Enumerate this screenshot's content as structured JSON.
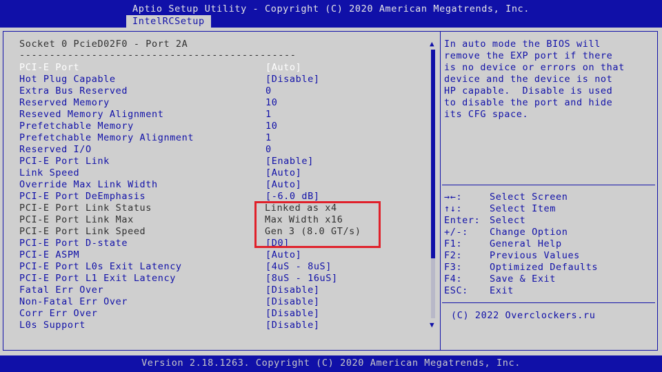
{
  "header": {
    "title": "Aptio Setup Utility - Copyright (C) 2020 American Megatrends, Inc.",
    "tab": "IntelRCSetup"
  },
  "section": {
    "title": "Socket 0 PcieD02F0 - Port 2A",
    "divider": "----------------------------------------------"
  },
  "settings": [
    {
      "label": "PCI-E Port",
      "value": "[Auto]"
    },
    {
      "label": "Hot Plug Capable",
      "value": "[Disable]"
    },
    {
      "label": "Extra Bus Reserved",
      "value": "0"
    },
    {
      "label": "Reserved Memory",
      "value": "10"
    },
    {
      "label": "Reseved Memory Alignment",
      "value": "1"
    },
    {
      "label": "Prefetchable Memory",
      "value": "10"
    },
    {
      "label": "Prefetchable Memory Alignment",
      "value": "1"
    },
    {
      "label": "Reserved I/O",
      "value": "0"
    },
    {
      "label": "PCI-E Port Link",
      "value": "[Enable]"
    },
    {
      "label": "Link Speed",
      "value": "[Auto]"
    },
    {
      "label": "Override Max Link Width",
      "value": "[Auto]"
    },
    {
      "label": "PCI-E Port DeEmphasis",
      "value": "[-6.0 dB]"
    },
    {
      "label": "PCI-E Port Link Status",
      "value": "Linked as x4"
    },
    {
      "label": "PCI-E Port Link Max",
      "value": "Max Width x16"
    },
    {
      "label": "PCI-E Port Link Speed",
      "value": "Gen 3 (8.0 GT/s)"
    },
    {
      "label": "PCI-E Port D-state",
      "value": "[D0]"
    },
    {
      "label": "PCI-E ASPM",
      "value": "[Auto]"
    },
    {
      "label": "PCI-E Port L0s Exit Latency",
      "value": "[4uS - 8uS]"
    },
    {
      "label": "PCI-E Port L1 Exit Latency",
      "value": "[8uS - 16uS]"
    },
    {
      "label": "Fatal Err Over",
      "value": "[Disable]"
    },
    {
      "label": "Non-Fatal Err Over",
      "value": "[Disable]"
    },
    {
      "label": "Corr Err Over",
      "value": "[Disable]"
    },
    {
      "label": "L0s Support",
      "value": "[Disable]"
    }
  ],
  "help": {
    "lines": [
      "In auto mode the BIOS will",
      "remove the EXP port if there",
      "is no device or errors on that",
      "device and the device is not",
      "HP capable.  Disable is used",
      "to disable the port and hide",
      "its CFG space."
    ]
  },
  "keys": [
    {
      "key": "→←:",
      "desc": "Select Screen"
    },
    {
      "key": "↑↓:",
      "desc": "Select Item"
    },
    {
      "key": "Enter:",
      "desc": "Select"
    },
    {
      "key": "+/-:",
      "desc": "Change Option"
    },
    {
      "key": "F1:",
      "desc": "General Help"
    },
    {
      "key": "F2:",
      "desc": "Previous Values"
    },
    {
      "key": "F3:",
      "desc": "Optimized Defaults"
    },
    {
      "key": "F4:",
      "desc": "Save & Exit"
    },
    {
      "key": "ESC:",
      "desc": "Exit"
    }
  ],
  "right_copyright": "(C) 2022 Overclockers.ru",
  "footer": {
    "version": "Version 2.18.1263. Copyright (C) 2020 American Megatrends, Inc."
  },
  "colors": {
    "bar_blue": "#1010a8",
    "background_gray": "#cfcfcf",
    "highlight_red": "#e0202a"
  }
}
